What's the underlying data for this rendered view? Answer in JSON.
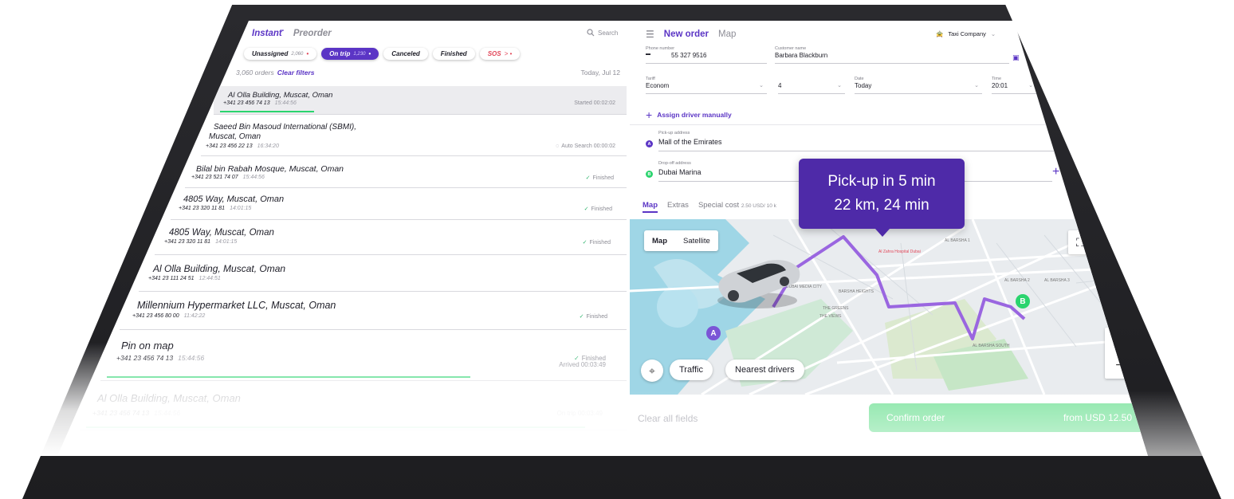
{
  "left": {
    "tabs": {
      "instant": "Instant",
      "instant_mark": "•",
      "preorder": "Preorder"
    },
    "search_label": "Search",
    "chips": [
      {
        "label": "Unassigned",
        "count": "2,060",
        "mark": "•"
      },
      {
        "label": "On trip",
        "count": "1,230",
        "mark": "•"
      },
      {
        "label": "Canceled"
      },
      {
        "label": "Finished"
      },
      {
        "label": "SOS",
        "count": "",
        "mark": "> •"
      }
    ],
    "orders_count": "3,060 orders",
    "clear_filters": "Clear filters",
    "date": "Today, Jul 12",
    "rows": [
      {
        "addr": "Al Olla Building, Muscat, Oman",
        "phone": "+341 23 456 74 13",
        "time": "15:44:56",
        "status": "Started 00:02:02",
        "progress": 0.31
      },
      {
        "addr": "Saeed Bin Masoud International (SBMI),",
        "addr2": "Muscat, Oman",
        "phone": "+341 23 456 22 13",
        "time": "16:34:20",
        "status": "Auto Search 00:00:02"
      },
      {
        "addr": "Bilal bin Rabah Mosque, Muscat, Oman",
        "phone": "+341 23 521 74 07",
        "time": "15:44:56",
        "status": "Finished"
      },
      {
        "addr": "4805 Way, Muscat, Oman",
        "phone": "+341 23 320 11 81",
        "time": "14:01:15",
        "status": "Finished"
      },
      {
        "addr": "4805 Way, Muscat, Oman",
        "phone": "+341 23 320 11 81",
        "time": "14:01:15",
        "status": "Finished"
      },
      {
        "addr": "Al Olla Building, Muscat, Oman",
        "phone": "+341 23 111 24 51",
        "time": "12:44:51",
        "status": ""
      },
      {
        "addr": "Millennium Hypermarket LLC, Muscat, Oman",
        "phone": "+341 23 456 80 00",
        "time": "11:42:22",
        "status": "Finished"
      },
      {
        "addr": "Pin on map",
        "phone": "+341 23 456 74 13",
        "time": "15:44:56",
        "status": "Finished",
        "status2": "Arrived 00:03:49",
        "progress": 0.72
      },
      {
        "addr": "Al Olla Building, Muscat, Oman",
        "phone": "+341 23 456 74 13",
        "time": "15:44:56",
        "status": "On trip 00:03:49",
        "progress": 0.9
      }
    ]
  },
  "right": {
    "menu_icon": "☰",
    "title": "New order",
    "map_tab": "Map",
    "company": "Taxi Company",
    "phone": {
      "label": "Phone number",
      "value": "55 327 9516"
    },
    "customer": {
      "label": "Customer name",
      "value": "Barbara Blackburn"
    },
    "tariff": {
      "label": "Tariff",
      "value": "Econom"
    },
    "seats": {
      "value": "4"
    },
    "date": {
      "label": "Date",
      "value": "Today"
    },
    "time": {
      "label": "Time",
      "value": "20:01"
    },
    "assign": "Assign driver manually",
    "pickup": {
      "label": "Pick-up address",
      "value": "Mall of the Emirates",
      "pin": "A"
    },
    "dropoff": {
      "label": "Drop-off address",
      "value": "Dubai Marina",
      "pin": "B"
    },
    "tabs": {
      "map": "Map",
      "extras": "Extras",
      "special": "Special cost",
      "special_value": "2.50 USD/ 10 k"
    },
    "map": {
      "toggle_map": "Map",
      "toggle_sat": "Satellite",
      "traffic": "Traffic",
      "nearest": "Nearest drivers",
      "zoom_in": "+",
      "zoom_out": "−",
      "pin_a": "A",
      "pin_b": "B",
      "labels": [
        "AL BARSHA 1",
        "AL BARSHA 2",
        "AL BARSHA 3",
        "BARSHA HEIGHTS",
        "THE GREENS",
        "THE VIEWS",
        "AL BARSHA SOUTH",
        "DUBAI MEDIA CITY",
        "Al Zahra Hospital Dubai"
      ]
    },
    "tooltip": {
      "line1": "Pick-up in 5 min",
      "line2": "22 km, 24 min"
    },
    "clear_all": "Clear all fields",
    "confirm": "Confirm order",
    "price": "from USD 12.50"
  },
  "colors": {
    "accent": "#5b35c5",
    "green": "#2bd46e",
    "route": "#9a66e0"
  }
}
